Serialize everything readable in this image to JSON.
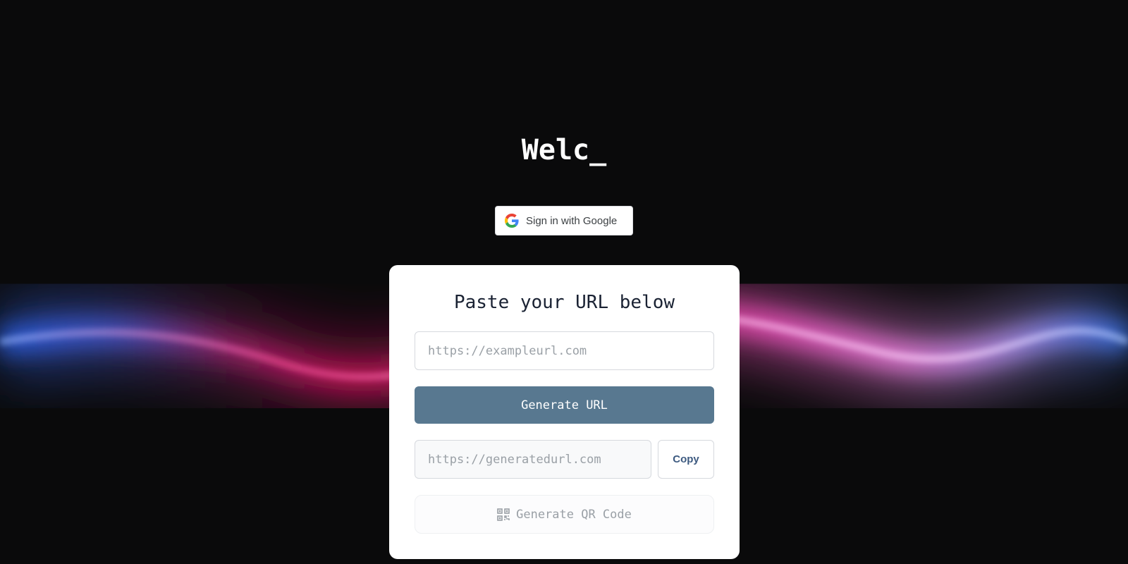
{
  "headline": {
    "text": "Welc_"
  },
  "auth": {
    "google_button_label": "Sign in with Google",
    "icon": "google-g-icon"
  },
  "card": {
    "title": "Paste your URL below",
    "url_input": {
      "value": "",
      "placeholder": "https://exampleurl.com"
    },
    "generate_button_label": "Generate URL",
    "generated_input": {
      "value": "",
      "placeholder": "https://generatedurl.com"
    },
    "copy_button_label": "Copy",
    "qr_button_label": "Generate QR Code",
    "qr_icon": "qr-code-icon"
  },
  "colors": {
    "background": "#0a0a0b",
    "card": "#ffffff",
    "primary_button": "#587890",
    "copy_text": "#3d5a80",
    "wave_blue": "#3b7bff",
    "wave_pink": "#ff5fd0",
    "wave_magenta": "#d0105a"
  }
}
